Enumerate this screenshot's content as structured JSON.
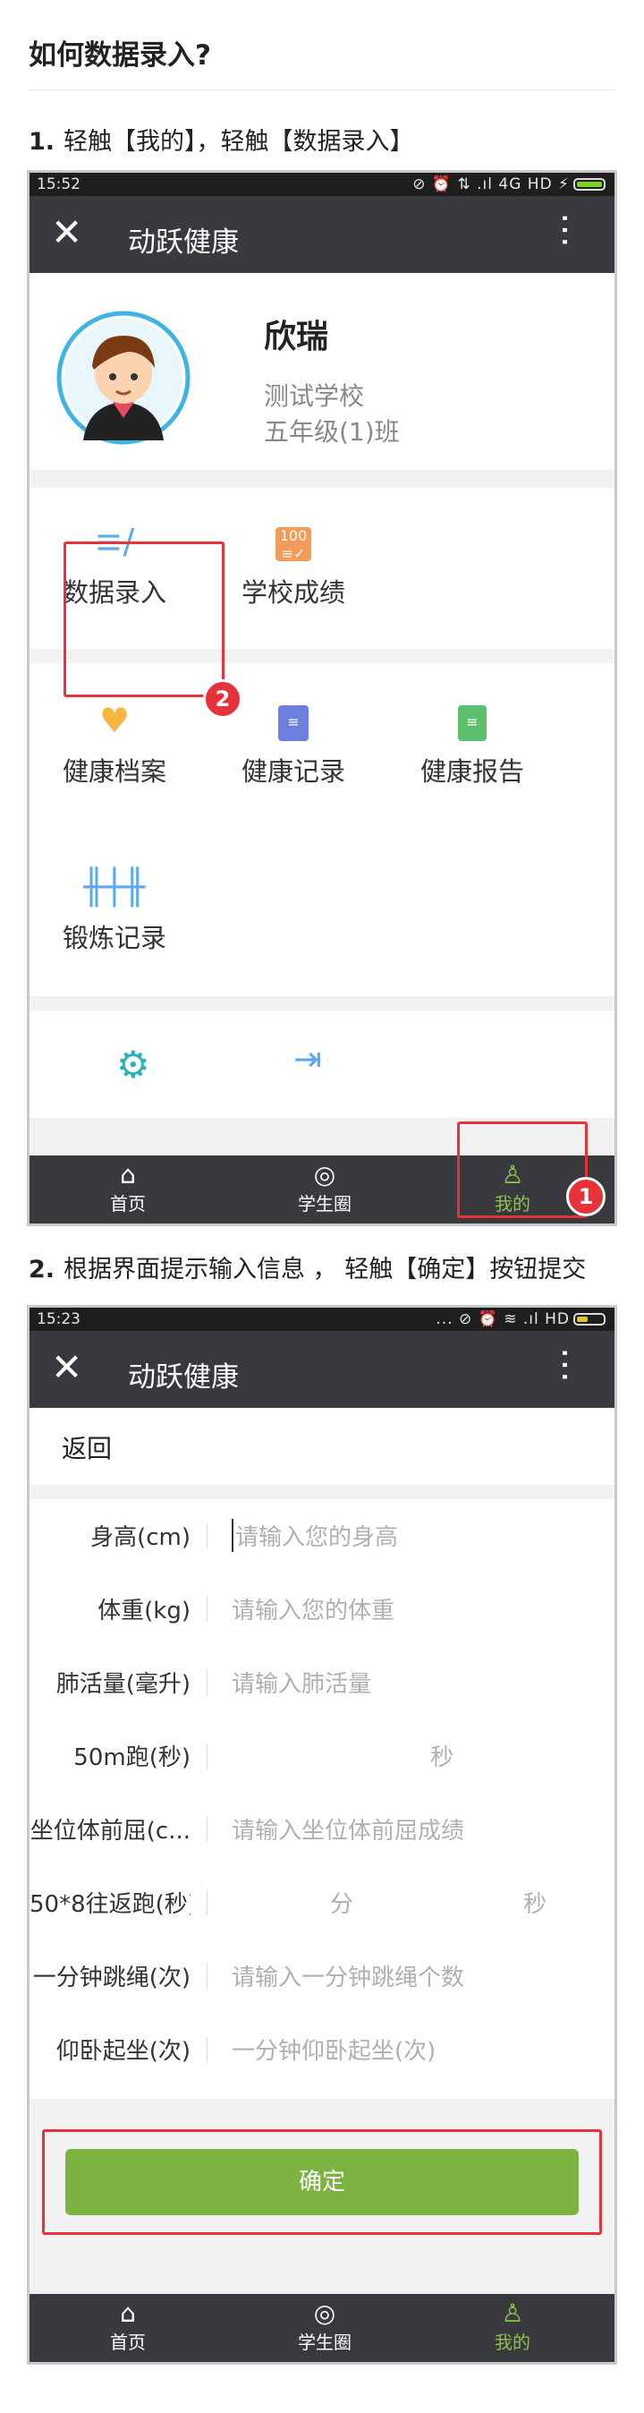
{
  "page_title": "如何数据录入?",
  "step1": {
    "num": "1.",
    "text": "轻触【我的】，轻触【数据录入】"
  },
  "step2": {
    "num": "2.",
    "text": "根据界面提示输入信息 ， 轻触【确定】按钮提交"
  },
  "shot1": {
    "status_time": "15:52",
    "status_icons": "⊘ ⏰ ⇅ .ıl 4G HD ⚡",
    "app_title": "动跃健康",
    "profile": {
      "name": "欣瑞",
      "school": "测试学校",
      "class": "五年级(1)班"
    },
    "row1": [
      {
        "label": "数据录入",
        "icon": "pen-lines-icon"
      },
      {
        "label": "学校成绩",
        "icon": "score-100-icon"
      }
    ],
    "row2": [
      {
        "label": "健康档案",
        "icon": "heart-icon"
      },
      {
        "label": "健康记录",
        "icon": "clipboard-icon"
      },
      {
        "label": "健康报告",
        "icon": "report-icon"
      }
    ],
    "row3": [
      {
        "label": "锻炼记录",
        "icon": "dumbbell-icon"
      }
    ],
    "badges": [
      "1",
      "2"
    ],
    "tabs": [
      {
        "label": "首页",
        "icon": "home-icon"
      },
      {
        "label": "学生圈",
        "icon": "chat-icon"
      },
      {
        "label": "我的",
        "icon": "person-icon"
      }
    ]
  },
  "shot2": {
    "status_time": "15:23",
    "status_icons": "... ⊘ ⏰ ≋ .ıl HD",
    "app_title": "动跃健康",
    "back": "返回",
    "fields": [
      {
        "label": "身高(cm)",
        "placeholder": "请输入您的身高"
      },
      {
        "label": "体重(kg)",
        "placeholder": "请输入您的体重"
      },
      {
        "label": "肺活量(毫升)",
        "placeholder": "请输入肺活量"
      },
      {
        "label": "50m跑(秒)",
        "unit": "秒"
      },
      {
        "label": "坐位体前屈(c...",
        "placeholder": "请输入坐位体前屈成绩"
      },
      {
        "label": "50*8往返跑(秒)",
        "unit_min": "分",
        "unit_sec": "秒"
      },
      {
        "label": "一分钟跳绳(次)",
        "placeholder": "请输入一分钟跳绳个数"
      },
      {
        "label": "仰卧起坐(次)",
        "placeholder": "一分钟仰卧起坐(次)"
      }
    ],
    "confirm": "确定",
    "tabs": [
      {
        "label": "首页"
      },
      {
        "label": "学生圈"
      },
      {
        "label": "我的"
      }
    ]
  },
  "colors": {
    "accent": "#7cb342",
    "highlight": "#e8323a",
    "bar": "#393a3e"
  }
}
